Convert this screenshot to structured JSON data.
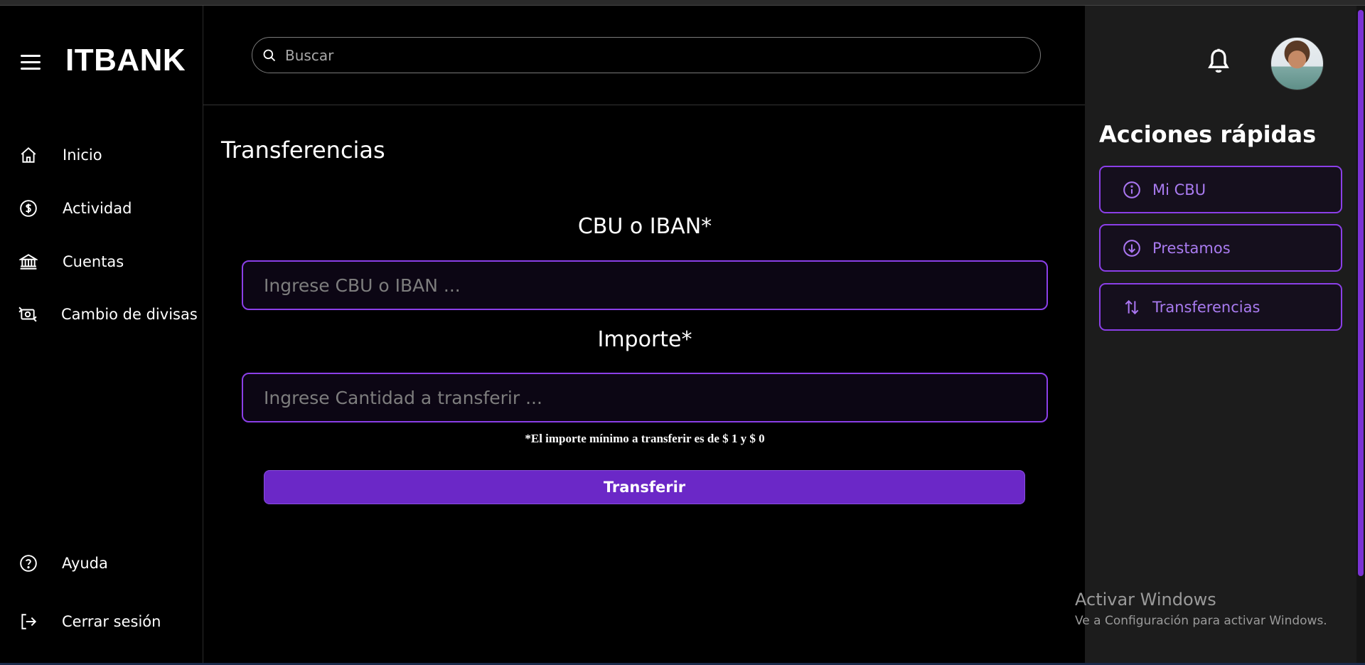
{
  "brand": {
    "logo": "ITBANK"
  },
  "search": {
    "placeholder": "Buscar"
  },
  "sidebar": {
    "items": [
      {
        "label": "Inicio",
        "icon": "home-icon"
      },
      {
        "label": "Actividad",
        "icon": "dollar-circle-icon"
      },
      {
        "label": "Cuentas",
        "icon": "bank-icon"
      },
      {
        "label": "Cambio de divisas",
        "icon": "currency-exchange-icon"
      }
    ],
    "bottom_items": [
      {
        "label": "Ayuda",
        "icon": "help-circle-icon"
      },
      {
        "label": "Cerrar sesión",
        "icon": "logout-icon"
      }
    ]
  },
  "main": {
    "title": "Transferencias",
    "cbu_label": "CBU o IBAN*",
    "cbu_placeholder": "Ingrese CBU o IBAN ...",
    "amount_label": "Importe*",
    "amount_placeholder": "Ingrese Cantidad a transferir ...",
    "note": "*El importe mínimo a transferir es de $ 1 y $ 0",
    "submit_label": "Transferir"
  },
  "quick_actions": {
    "title": "Acciones rápidas",
    "items": [
      {
        "label": "Mi CBU",
        "icon": "info-circle-icon"
      },
      {
        "label": "Prestamos",
        "icon": "arrow-down-circle-icon"
      },
      {
        "label": "Transferencias",
        "icon": "arrows-up-down-icon"
      }
    ]
  },
  "windows_watermark": {
    "title": "Activar Windows",
    "subtitle": "Ve a Configuración para activar Windows."
  },
  "colors": {
    "accent": "#8b3fe8",
    "button": "#6b28c7",
    "panel": "#1c1c1c",
    "background": "#000000"
  }
}
